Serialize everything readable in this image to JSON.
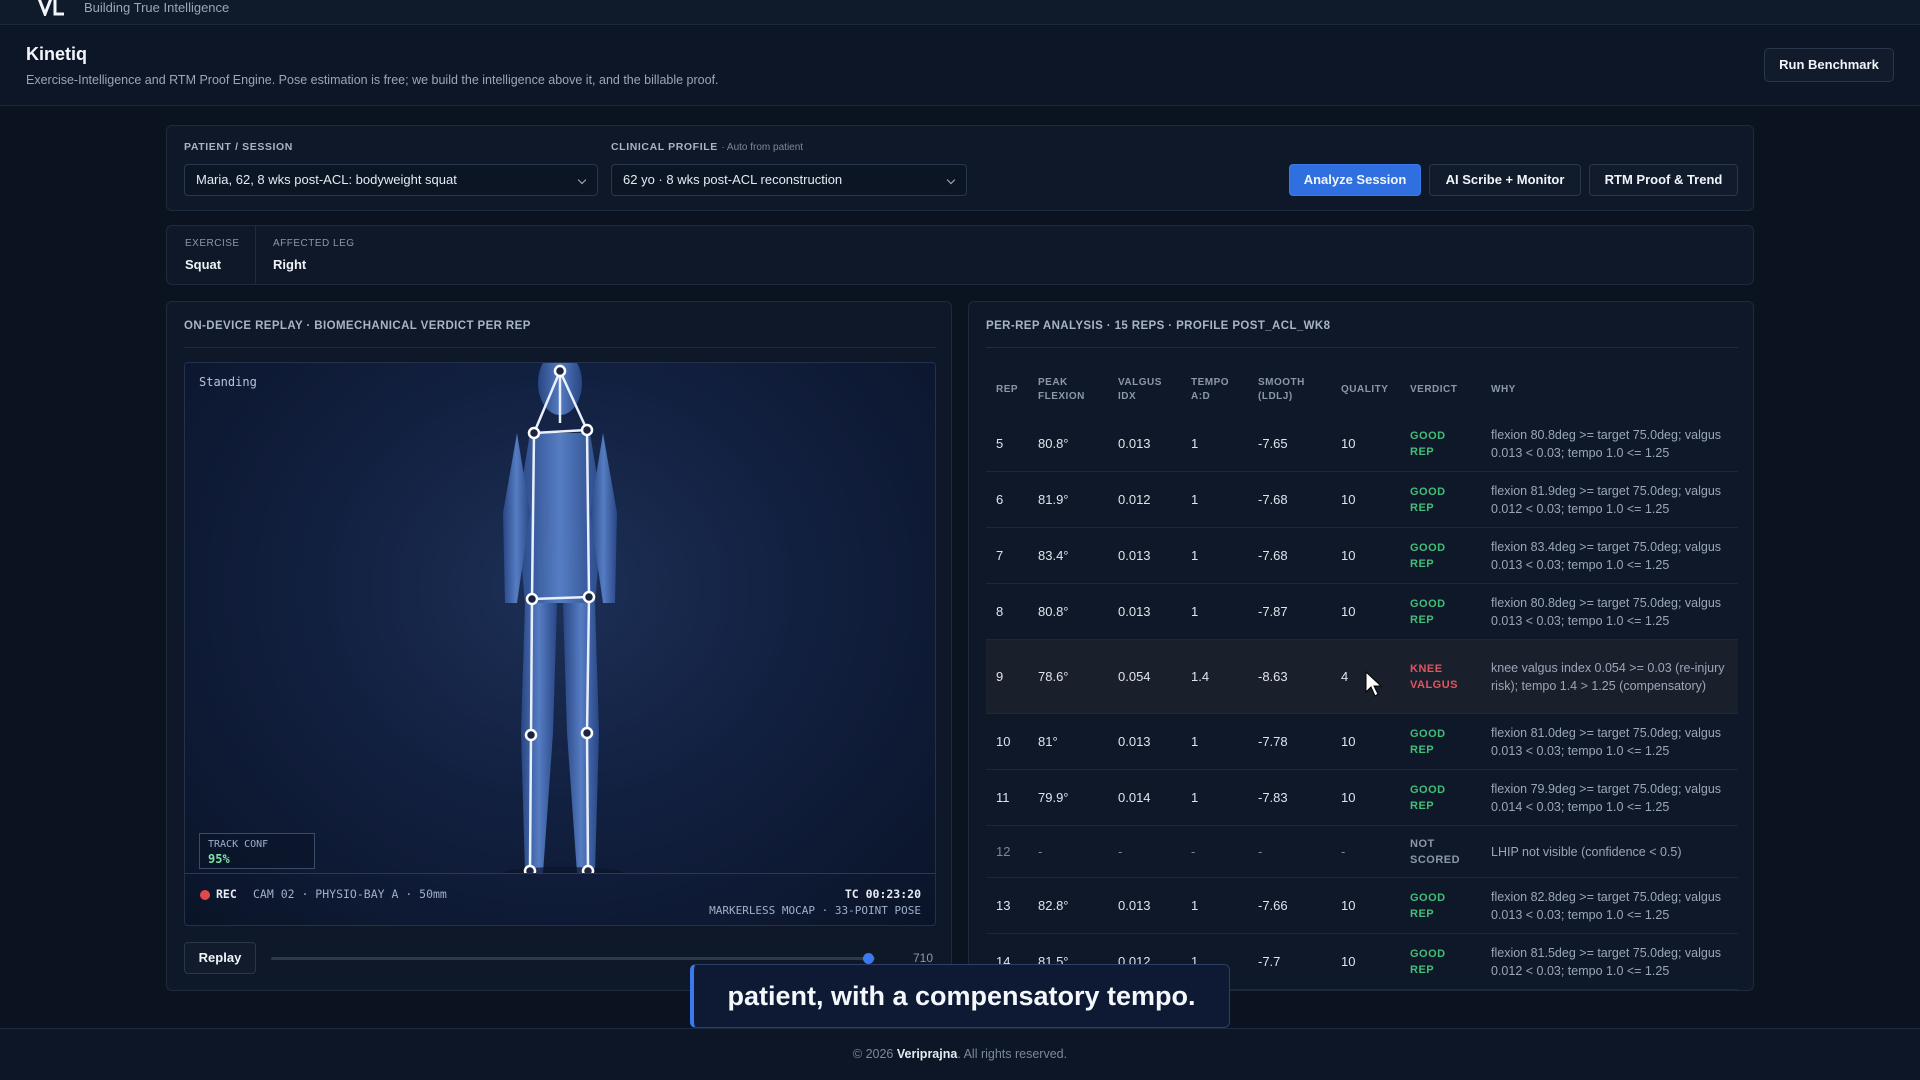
{
  "topbar": {
    "tagline": "Building True Intelligence"
  },
  "header": {
    "title": "Kinetiq",
    "subtitle": "Exercise-Intelligence and RTM Proof Engine. Pose estimation is free; we build the intelligence above it, and the billable proof.",
    "run_benchmark_label": "Run Benchmark"
  },
  "session": {
    "patient_label": "PATIENT / SESSION",
    "patient_value": "Maria, 62, 8 wks post-ACL: bodyweight squat",
    "profile_label": "CLINICAL PROFILE",
    "profile_sub": "· Auto from patient",
    "profile_value": "62 yo · 8 wks post-ACL reconstruction",
    "analyze_label": "Analyze Session",
    "scribe_label": "AI Scribe + Monitor",
    "rtm_label": "RTM Proof & Trend"
  },
  "info": {
    "exercise_label": "EXERCISE",
    "exercise_value": "Squat",
    "leg_label": "AFFECTED LEG",
    "leg_value": "Right"
  },
  "replay": {
    "heading": "ON-DEVICE REPLAY · BIOMECHANICAL VERDICT PER REP",
    "state": "Standing",
    "track_conf_label": "TRACK CONF",
    "track_conf_value": "95%",
    "rec": "REC",
    "camera": "CAM 02 · PHYSIO-BAY A · 50mm",
    "timecode": "TC 00:23:20",
    "mocap": "MARKERLESS MOCAP · 33-POINT POSE",
    "replay_label": "Replay",
    "frame": "710",
    "progress": 0.99
  },
  "analysis": {
    "heading": "PER-REP ANALYSIS · 15 REPS · PROFILE POST_ACL_WK8",
    "columns": {
      "rep": "REP",
      "flex1": "PEAK",
      "flex2": "FLEXION",
      "valgus1": "VALGUS",
      "valgus2": "IDX",
      "tempo1": "TEMPO",
      "tempo2": "A:D",
      "smooth1": "SMOOTH",
      "smooth2": "(LDLJ)",
      "quality": "QUALITY",
      "verdict": "VERDICT",
      "why": "WHY"
    },
    "rows": [
      {
        "rep": "5",
        "flex": "80.8°",
        "valgus": "0.013",
        "tempo": "1",
        "smooth": "-7.65",
        "quality": "10",
        "v1": "GOOD",
        "v2": "REP",
        "why": "flexion 80.8deg >= target 75.0deg; valgus 0.013 < 0.03; tempo 1.0 <= 1.25"
      },
      {
        "rep": "6",
        "flex": "81.9°",
        "valgus": "0.012",
        "tempo": "1",
        "smooth": "-7.68",
        "quality": "10",
        "v1": "GOOD",
        "v2": "REP",
        "why": "flexion 81.9deg >= target 75.0deg; valgus 0.012 < 0.03; tempo 1.0 <= 1.25"
      },
      {
        "rep": "7",
        "flex": "83.4°",
        "valgus": "0.013",
        "tempo": "1",
        "smooth": "-7.68",
        "quality": "10",
        "v1": "GOOD",
        "v2": "REP",
        "why": "flexion 83.4deg >= target 75.0deg; valgus 0.013 < 0.03; tempo 1.0 <= 1.25"
      },
      {
        "rep": "8",
        "flex": "80.8°",
        "valgus": "0.013",
        "tempo": "1",
        "smooth": "-7.87",
        "quality": "10",
        "v1": "GOOD",
        "v2": "REP",
        "why": "flexion 80.8deg >= target 75.0deg; valgus 0.013 < 0.03; tempo 1.0 <= 1.25"
      },
      {
        "rep": "9",
        "flex": "78.6°",
        "valgus": "0.054",
        "tempo": "1.4",
        "smooth": "-8.63",
        "quality": "4",
        "v1": "KNEE",
        "v2": "VALGUS",
        "why": "knee valgus index 0.054 >= 0.03 (re-injury risk); tempo 1.4 > 1.25 (compensatory)"
      },
      {
        "rep": "10",
        "flex": "81°",
        "valgus": "0.013",
        "tempo": "1",
        "smooth": "-7.78",
        "quality": "10",
        "v1": "GOOD",
        "v2": "REP",
        "why": "flexion 81.0deg >= target 75.0deg; valgus 0.013 < 0.03; tempo 1.0 <= 1.25"
      },
      {
        "rep": "11",
        "flex": "79.9°",
        "valgus": "0.014",
        "tempo": "1",
        "smooth": "-7.83",
        "quality": "10",
        "v1": "GOOD",
        "v2": "REP",
        "why": "flexion 79.9deg >= target 75.0deg; valgus 0.014 < 0.03; tempo 1.0 <= 1.25"
      },
      {
        "rep": "12",
        "flex": "-",
        "valgus": "-",
        "tempo": "-",
        "smooth": "-",
        "quality": "-",
        "v1": "NOT",
        "v2": "SCORED",
        "why": "LHIP not visible (confidence < 0.5)"
      },
      {
        "rep": "13",
        "flex": "82.8°",
        "valgus": "0.013",
        "tempo": "1",
        "smooth": "-7.66",
        "quality": "10",
        "v1": "GOOD",
        "v2": "REP",
        "why": "flexion 82.8deg >= target 75.0deg; valgus 0.013 < 0.03; tempo 1.0 <= 1.25"
      },
      {
        "rep": "14",
        "flex": "81.5°",
        "valgus": "0.012",
        "tempo": "1",
        "smooth": "-7.7",
        "quality": "10",
        "v1": "GOOD",
        "v2": "REP",
        "why": "flexion 81.5deg >= target 75.0deg; valgus 0.012 < 0.03; tempo 1.0 <= 1.25"
      }
    ]
  },
  "caption": {
    "text": "patient, with a compensatory tempo."
  },
  "footer": {
    "prefix": "© 2026",
    "brand": "Veriprajna",
    "suffix": ". All rights reserved."
  },
  "colors": {
    "accent": "#2f6fe0",
    "good": "#3fbf78",
    "bad": "#e05560",
    "background": "#0b1220"
  }
}
